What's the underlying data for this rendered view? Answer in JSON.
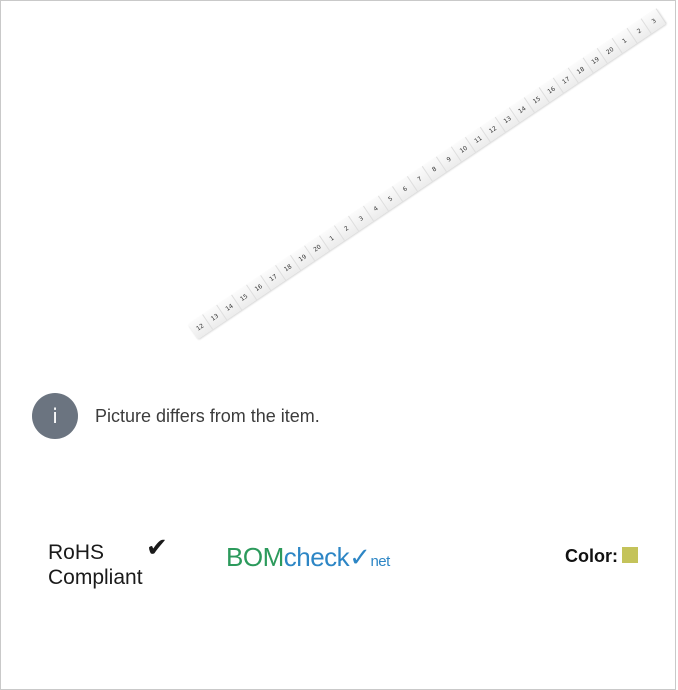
{
  "product": {
    "marker_labels": [
      "12",
      "13",
      "14",
      "15",
      "16",
      "17",
      "18",
      "19",
      "20",
      "1",
      "2",
      "3",
      "4",
      "5",
      "6",
      "7",
      "8",
      "9",
      "10",
      "11",
      "12",
      "13",
      "14",
      "15",
      "16",
      "17",
      "18",
      "19",
      "20",
      "1",
      "2",
      "3"
    ]
  },
  "notice": {
    "icon": "info-icon",
    "icon_glyph": "i",
    "text": "Picture differs from the item."
  },
  "compliance": {
    "rohs_line1": "RoHS",
    "rohs_line2": "Compliant",
    "rohs_check": "✔",
    "bomcheck_part1": "BOM",
    "bomcheck_part2": "check",
    "bomcheck_tick": "✓",
    "bomcheck_part3": "net"
  },
  "color": {
    "label": "Color:",
    "swatch_color": "#c4c35a"
  }
}
